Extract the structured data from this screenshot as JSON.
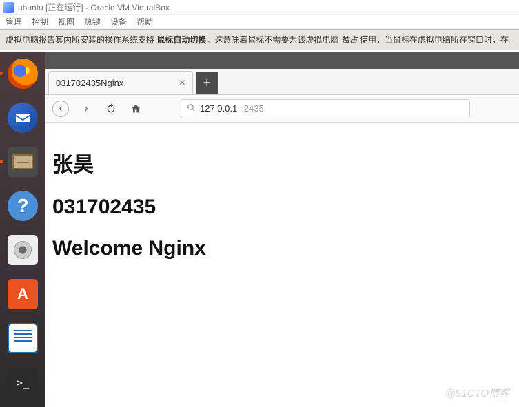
{
  "vbox": {
    "title": "ubuntu [正在运行] - Oracle VM VirtualBox",
    "menu": [
      "管理",
      "控制",
      "视图",
      "热键",
      "设备",
      "帮助"
    ],
    "infobar_pre": "虚拟电脑报告其内所安装的操作系统支持 ",
    "infobar_bold": "鼠标自动切换",
    "infobar_post1": "。这意味着鼠标不需要为该虚拟电脑 ",
    "infobar_italic": "独占",
    "infobar_post2": " 使用，当鼠标在虚拟电脑所在窗口时，在"
  },
  "launcher": {
    "items": [
      {
        "name": "firefox",
        "running": true
      },
      {
        "name": "thunderbird",
        "running": false
      },
      {
        "name": "files",
        "running": true
      },
      {
        "name": "help",
        "running": false
      },
      {
        "name": "rhythmbox",
        "running": false
      },
      {
        "name": "software",
        "running": false
      },
      {
        "name": "libreoffice-writer",
        "running": false
      },
      {
        "name": "terminal",
        "running": false
      }
    ]
  },
  "firefox": {
    "tab_title": "031702435Nginx",
    "close_glyph": "×",
    "newtab_glyph": "+",
    "url_host": "127.0.0.1",
    "url_port": ":2435"
  },
  "page": {
    "h1": "张昊",
    "h2": "031702435",
    "h3": "Welcome Nginx"
  },
  "watermark": "@51CTO博客"
}
